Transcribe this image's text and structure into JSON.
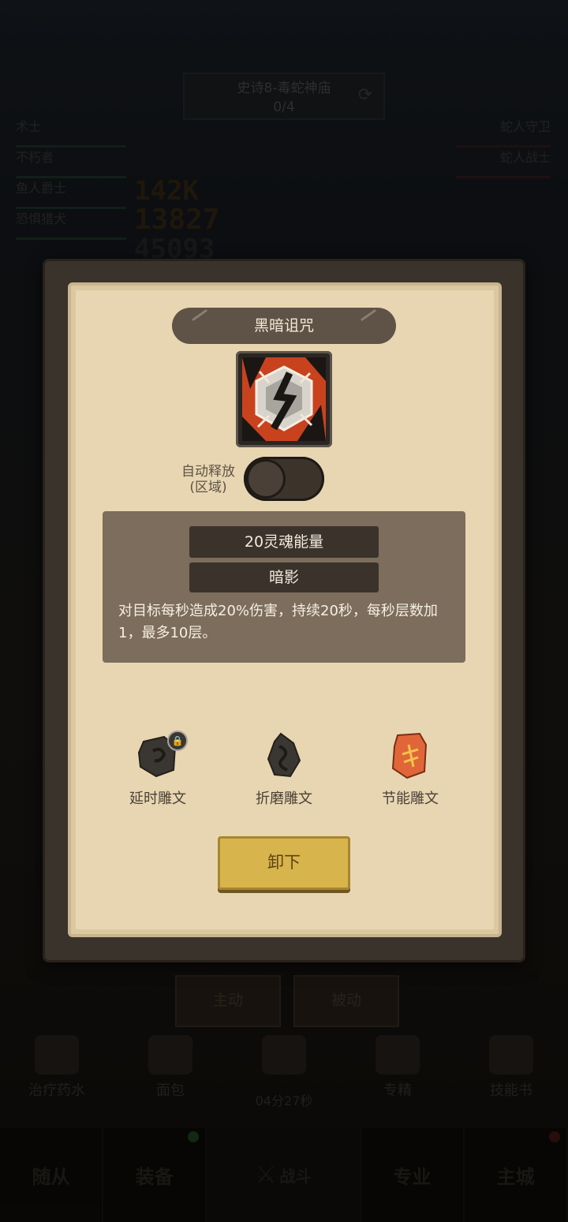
{
  "background": {
    "stage_title": "史诗8-毒蛇神庙",
    "stage_progress": "0/4",
    "party_left": [
      "术士",
      "不朽者",
      "鱼人爵士",
      "恐惧猎犬"
    ],
    "party_right": [
      "蛇人守卫",
      "蛇人战士"
    ],
    "damage_numbers": [
      "142K",
      "13827",
      "45093"
    ],
    "tabs": [
      "主动",
      "被动"
    ],
    "items": [
      "治疗药水",
      "面包",
      "",
      "专精",
      "技能书"
    ],
    "timer": "04分27秒",
    "nav": [
      "随从",
      "装备",
      "战斗",
      "专业",
      "主城"
    ]
  },
  "modal": {
    "title": "黑暗诅咒",
    "skill_icon": "dark-curse-skill-icon",
    "auto_cast_label_line1": "自动释放",
    "auto_cast_label_line2": "(区域)",
    "auto_cast_enabled": false,
    "cost": "20灵魂能量",
    "element": "暗影",
    "description": "对目标每秒造成20%伤害，持续20秒，每秒层数加1，最多10层。",
    "runes": [
      {
        "label": "延时雕文",
        "icon": "rune-stone-locked-icon",
        "locked": true
      },
      {
        "label": "折磨雕文",
        "icon": "rune-stone-icon",
        "locked": false
      },
      {
        "label": "节能雕文",
        "icon": "rune-stone-orange-icon",
        "locked": false
      }
    ],
    "unload_label": "卸下"
  },
  "colors": {
    "parchment": "#e8d6b2",
    "frame": "#3a332b",
    "button_gold": "#d8b44c",
    "rune_orange": "#e0663a"
  }
}
